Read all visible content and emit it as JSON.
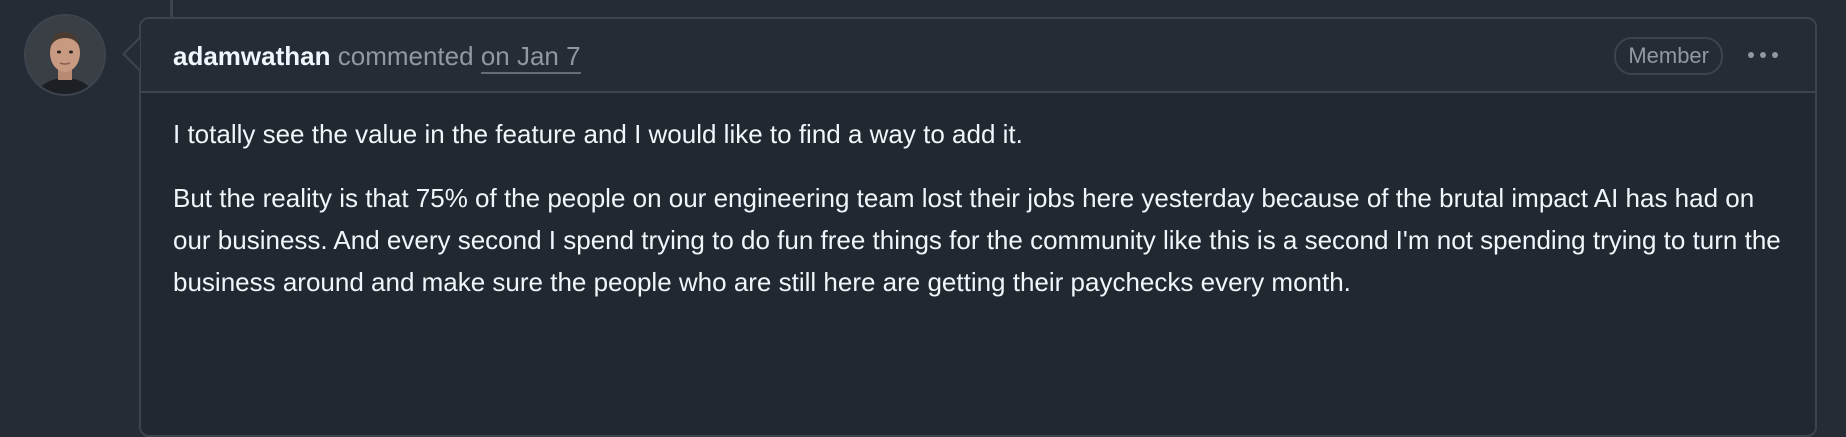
{
  "comment": {
    "author": "adamwathan",
    "action": "commented",
    "date": "on Jan 7",
    "badge": "Member",
    "menu_icon": "kebab-horizontal-icon",
    "avatar_icon": "user-avatar",
    "paragraphs": [
      "I totally see the value in the feature and I would like to find a way to add it.",
      "But the reality is that 75% of the people on our engineering team lost their jobs here yesterday because of the brutal impact AI has had on our business. And every second I spend trying to do fun free things for the community like this is a second I'm not spending trying to turn the business around and make sure the people who are still here are getting their paychecks every month."
    ]
  },
  "colors": {
    "page_background": "#262c36",
    "comment_background": "#212830",
    "border": "#3d444d",
    "text_primary": "#f0f6fc",
    "text_muted": "#9198a1"
  }
}
